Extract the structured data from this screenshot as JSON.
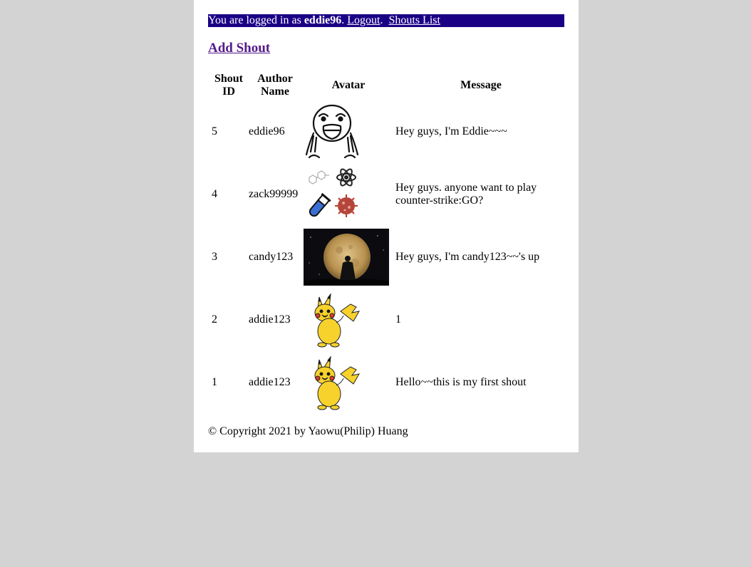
{
  "topbar": {
    "prefix": "You are logged in as",
    "username": "eddie96",
    "sep1": ".",
    "logout_label": "Logout",
    "sep2": ".",
    "shouts_list_label": "Shouts List"
  },
  "add_shout_label": "Add Shout",
  "table": {
    "headers": {
      "id_line1": "Shout",
      "id_line2": "ID",
      "author_line1": "Author",
      "author_line2": "Name",
      "avatar": "Avatar",
      "message": "Message"
    },
    "rows": [
      {
        "id": "5",
        "author": "eddie96",
        "avatar": "rage-comic-face-avatar",
        "message": "Hey guys, I'm Eddie~~~"
      },
      {
        "id": "4",
        "author": "zack99999",
        "avatar": "science-icons-avatar",
        "message": "Hey guys. anyone want to play counter-strike:GO?"
      },
      {
        "id": "3",
        "author": "candy123",
        "avatar": "moon-silhouette-avatar",
        "message": "Hey guys, I'm candy123~~'s up"
      },
      {
        "id": "2",
        "author": "addie123",
        "avatar": "pikachu-avatar",
        "message": "1"
      },
      {
        "id": "1",
        "author": "addie123",
        "avatar": "pikachu-avatar",
        "message": "Hello~~this is my first shout"
      }
    ]
  },
  "footer": "© Copyright 2021 by Yaowu(Philip) Huang",
  "colors": {
    "page_bg": "#d3d3d3",
    "container_bg": "#ffffff",
    "topbar_bg": "#1a0085",
    "link_visited": "#551a8b"
  }
}
